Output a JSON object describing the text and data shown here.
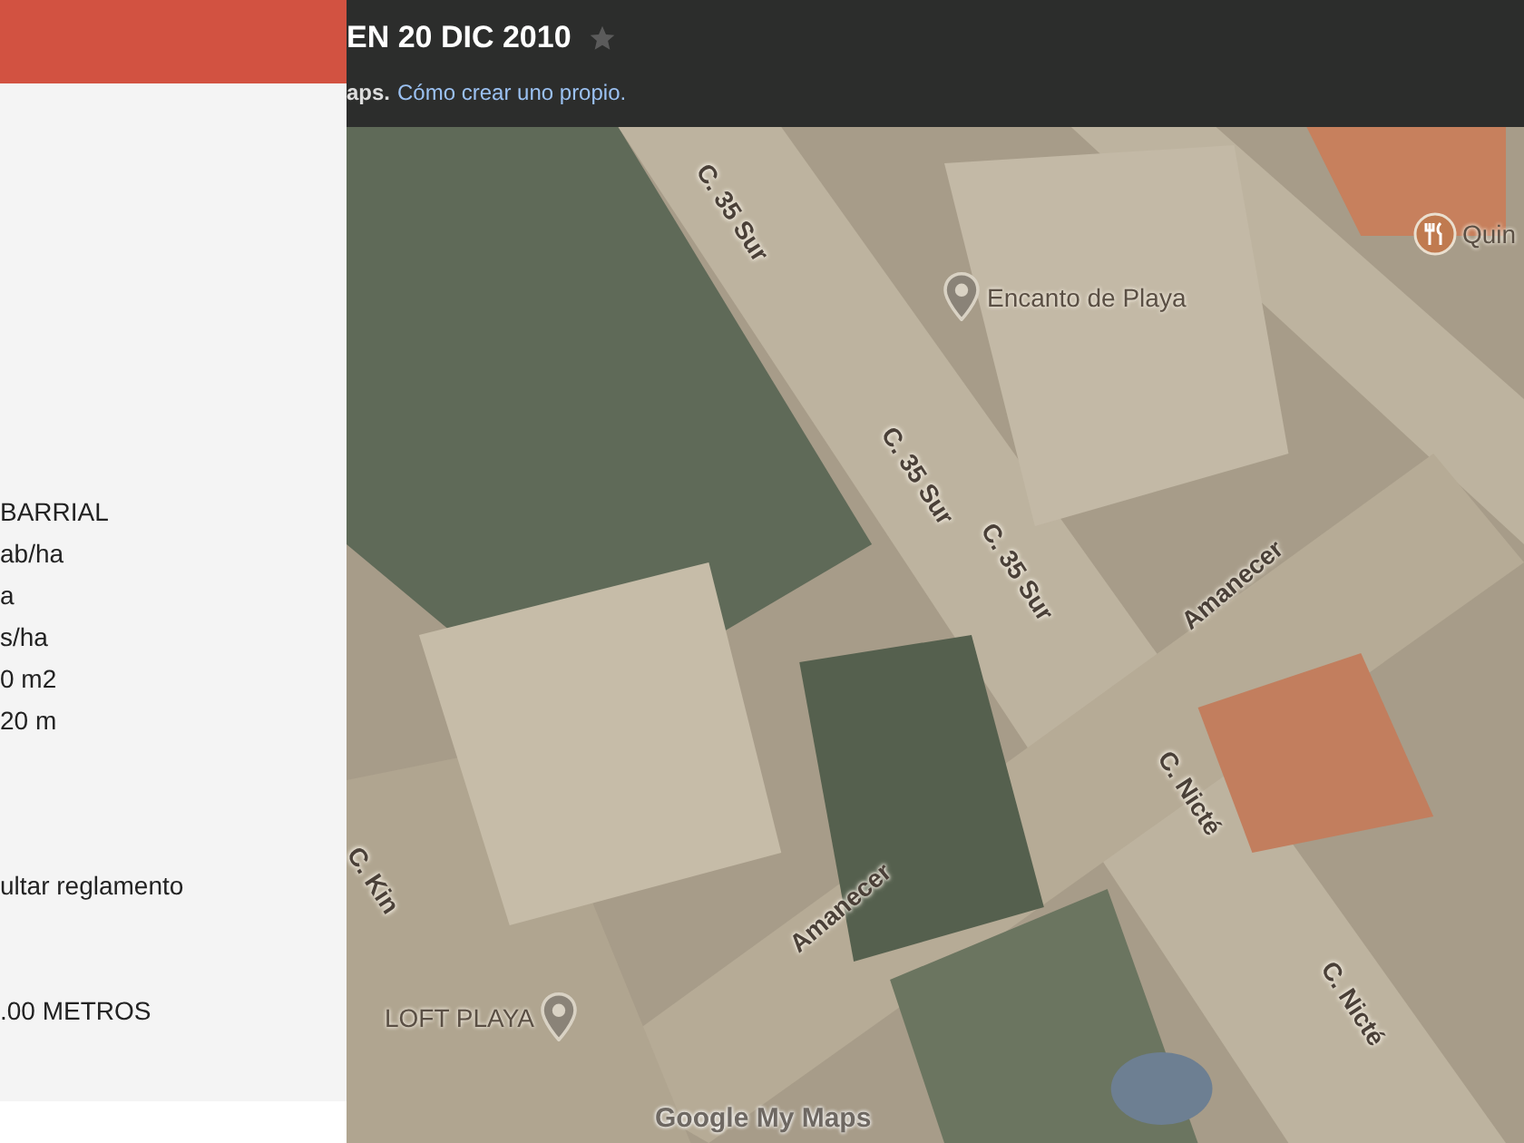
{
  "panel": {
    "lines": [
      "BARRIAL",
      "ab/ha",
      "a",
      "s/ha",
      "0 m2",
      "20 m",
      "ultar reglamento",
      ".00 METROS"
    ]
  },
  "header": {
    "title": "EN 20 DIC 2010",
    "starred": false,
    "subtitle": "aps.",
    "link": "Cómo crear uno propio."
  },
  "map": {
    "labels": [
      {
        "kind": "street",
        "text": "C. 35 Sur"
      },
      {
        "kind": "place",
        "text": "Encanto de Playa"
      },
      {
        "kind": "restaurant",
        "text": "Quin"
      },
      {
        "kind": "street",
        "text": "C. 35 Sur"
      },
      {
        "kind": "street",
        "text": "C. 35 Sur"
      },
      {
        "kind": "street",
        "text": "Amanecer"
      },
      {
        "kind": "street",
        "text": "C. Nicté"
      },
      {
        "kind": "street",
        "text": "C. Kin"
      },
      {
        "kind": "street",
        "text": "Amanecer"
      },
      {
        "kind": "place",
        "text": "LOFT PLAYA"
      },
      {
        "kind": "street",
        "text": "C. Nicté"
      }
    ],
    "attribution": "Google My Maps"
  }
}
